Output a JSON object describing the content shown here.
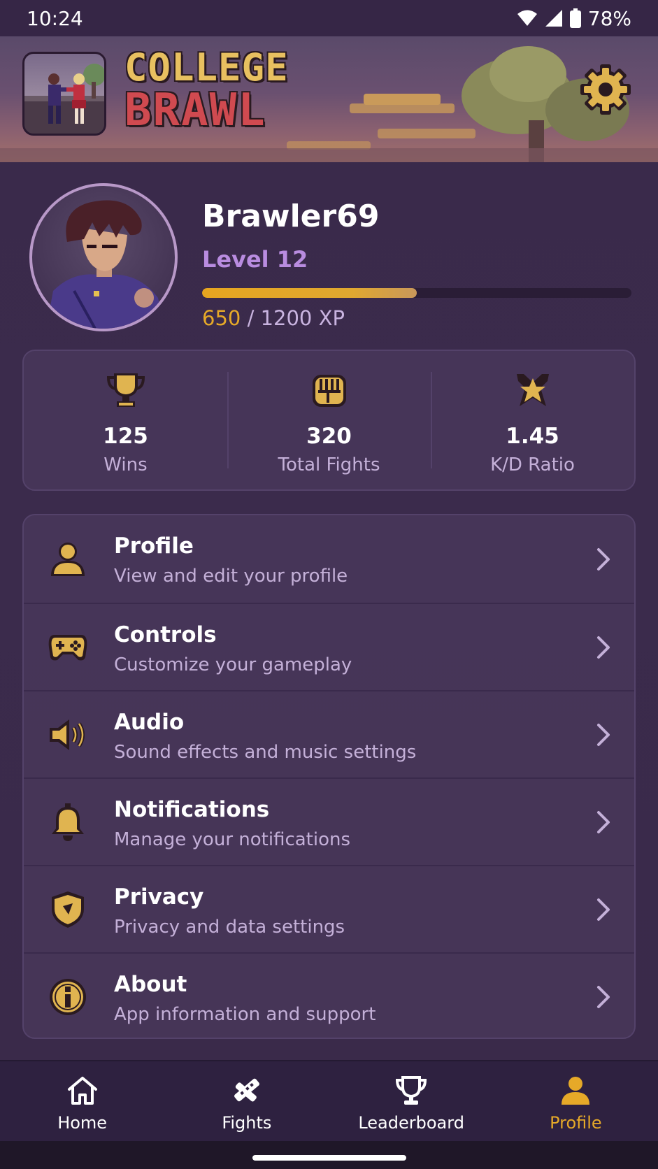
{
  "status_bar": {
    "time": "10:24",
    "battery": "78%"
  },
  "header": {
    "title_line1": "COLLEGE",
    "title_line2": "BRAWL"
  },
  "player": {
    "username": "Brawler69",
    "level": "Level 12",
    "xp_current": "650",
    "xp_rest": " / 1200 XP",
    "xp_progress": 0.5
  },
  "stats": [
    {
      "icon": "trophy-icon",
      "value": "125",
      "label": "Wins"
    },
    {
      "icon": "fist-icon",
      "value": "320",
      "label": "Total Fights"
    },
    {
      "icon": "star-icon",
      "value": "1.45",
      "label": "K/D Ratio"
    }
  ],
  "menu": [
    {
      "icon": "person-icon",
      "title": "Profile",
      "subtitle": "View and edit your profile"
    },
    {
      "icon": "gamepad-icon",
      "title": "Controls",
      "subtitle": "Customize your gameplay"
    },
    {
      "icon": "speaker-icon",
      "title": "Audio",
      "subtitle": "Sound effects and music settings"
    },
    {
      "icon": "bell-icon",
      "title": "Notifications",
      "subtitle": "Manage your notifications"
    },
    {
      "icon": "shield-icon",
      "title": "Privacy",
      "subtitle": "Privacy and data settings"
    },
    {
      "icon": "info-icon",
      "title": "About",
      "subtitle": "App information and support"
    }
  ],
  "nav": [
    {
      "icon": "home-icon",
      "label": "Home",
      "active": false
    },
    {
      "icon": "crossed-swords-icon",
      "label": "Fights",
      "active": false
    },
    {
      "icon": "trophy-icon",
      "label": "Leaderboard",
      "active": false
    },
    {
      "icon": "person-icon",
      "label": "Profile",
      "active": true
    }
  ],
  "colors": {
    "accent_gold": "#e6a928",
    "level_purple": "#b98ce0",
    "background": "#3a2a4a"
  }
}
